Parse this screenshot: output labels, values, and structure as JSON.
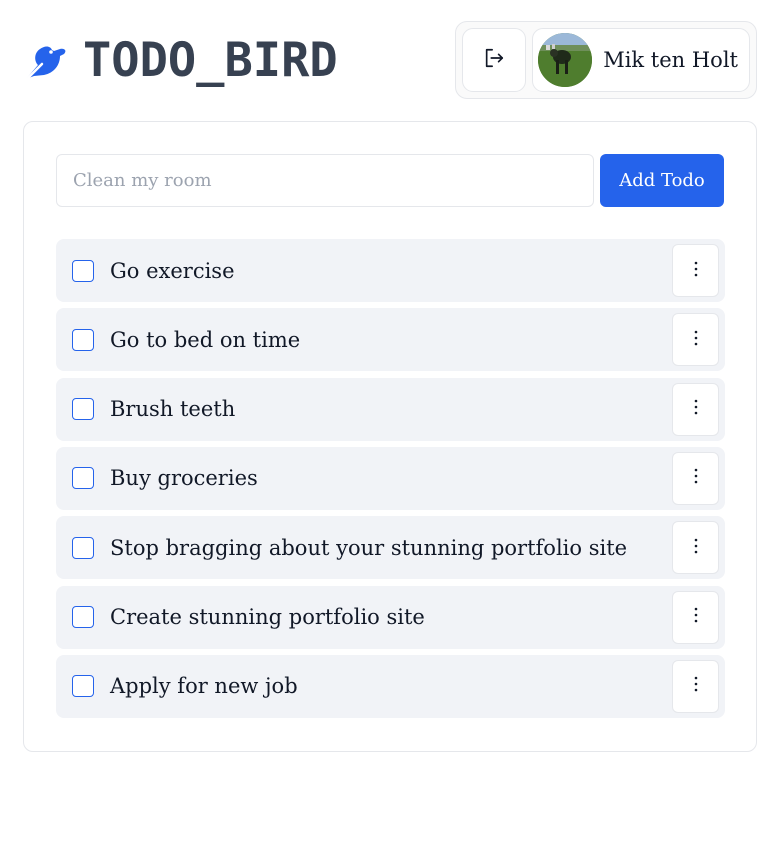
{
  "app": {
    "title": "TODO_BIRD",
    "accent_color": "#2563eb",
    "logo_icon": "bird-icon"
  },
  "user": {
    "name": "Mik ten Holt",
    "logout_icon": "logout-icon",
    "avatar_alt": "user-avatar"
  },
  "add_form": {
    "placeholder": "Clean my room",
    "value": "",
    "button_label": "Add Todo"
  },
  "todos": [
    {
      "text": "Go exercise",
      "completed": false
    },
    {
      "text": "Go to bed on time",
      "completed": false
    },
    {
      "text": "Brush teeth",
      "completed": false
    },
    {
      "text": "Buy groceries",
      "completed": false
    },
    {
      "text": "Stop bragging about your stunning portfolio site",
      "completed": false
    },
    {
      "text": "Create stunning portfolio site",
      "completed": false
    },
    {
      "text": "Apply for new job",
      "completed": false
    }
  ],
  "item_menu_icon": "more-vertical-icon"
}
